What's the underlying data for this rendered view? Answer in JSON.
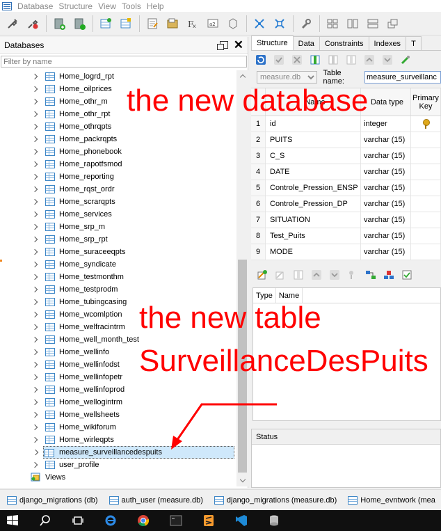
{
  "menu": [
    "Database",
    "Structure",
    "View",
    "Tools",
    "Help"
  ],
  "db_panel": {
    "title": "Databases",
    "filter_placeholder": "Filter by name",
    "tables": [
      "Home_logrd_rpt",
      "Home_oilprices",
      "Home_othr_m",
      "Home_othr_rpt",
      "Home_othrqpts",
      "Home_packrqpts",
      "Home_phonebook",
      "Home_rapotfsmod",
      "Home_reporting",
      "Home_rqst_ordr",
      "Home_scrarqpts",
      "Home_services",
      "Home_srp_m",
      "Home_srp_rpt",
      "Home_suraceeqpts",
      "Home_syndicate",
      "Home_testmonthm",
      "Home_testprodm",
      "Home_tubingcasing",
      "Home_wcomlption",
      "Home_welfracintrm",
      "Home_well_month_test",
      "Home_wellinfo",
      "Home_wellinfodst",
      "Home_wellinfopetr",
      "Home_wellinfoprod",
      "Home_wellogintrm",
      "Home_wellsheets",
      "Home_wikiforum",
      "Home_wirleqpts"
    ],
    "selected_table": "measure_surveillancedespuits",
    "after_selected": [
      "user_profile"
    ],
    "views_label": "Views"
  },
  "right_panel": {
    "tabs": [
      "Structure",
      "Data",
      "Constraints",
      "Indexes",
      "T"
    ],
    "active_tab": "Structure",
    "db_select": "measure.db",
    "table_name_label": "Table name:",
    "table_name_value": "measure_surveillanc",
    "columns_header": {
      "name": "Name",
      "type": "Data type",
      "pk": "Primary Key"
    },
    "columns": [
      {
        "n": "1",
        "name": "id",
        "type": "integer",
        "pk": true
      },
      {
        "n": "2",
        "name": "PUITS",
        "type": "varchar (15)",
        "pk": false
      },
      {
        "n": "3",
        "name": "C_S",
        "type": "varchar (15)",
        "pk": false
      },
      {
        "n": "4",
        "name": "DATE",
        "type": "varchar (15)",
        "pk": false
      },
      {
        "n": "5",
        "name": "Controle_Pression_ENSP",
        "type": "varchar (15)",
        "pk": false
      },
      {
        "n": "6",
        "name": "Controle_Pression_DP",
        "type": "varchar (15)",
        "pk": false
      },
      {
        "n": "7",
        "name": "SITUATION",
        "type": "varchar (15)",
        "pk": false
      },
      {
        "n": "8",
        "name": "Test_Puits",
        "type": "varchar (15)",
        "pk": false
      },
      {
        "n": "9",
        "name": "MODE",
        "type": "varchar (15)",
        "pk": false
      }
    ],
    "lower_header": {
      "type": "Type",
      "name": "Name"
    },
    "status_label": "Status"
  },
  "task_windows": [
    "django_migrations (db)",
    "auth_user (measure.db)",
    "django_migrations (measure.db)",
    "Home_evntwork (mea"
  ],
  "annotations": {
    "new_database": "the new database",
    "new_table_line1": "the new table",
    "new_table_line2": "SurveillanceDesPuits"
  },
  "colors": {
    "annotation": "#ff0000",
    "selection": "#cfe8fb",
    "taskbar": "#101010"
  }
}
